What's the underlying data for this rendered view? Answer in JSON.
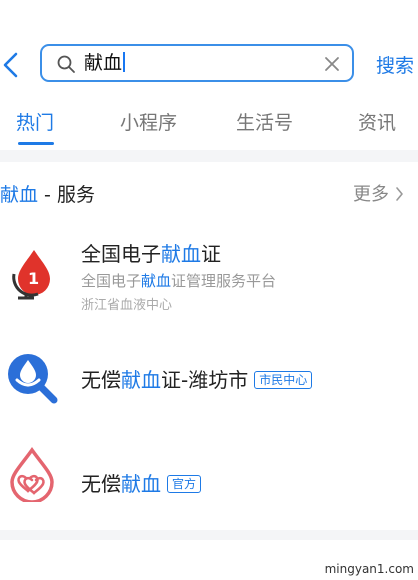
{
  "search": {
    "query": "献血",
    "submit_label": "搜索"
  },
  "tabs": [
    {
      "label": "热门",
      "active": true
    },
    {
      "label": "小程序",
      "active": false
    },
    {
      "label": "生活号",
      "active": false
    },
    {
      "label": "资讯",
      "active": false
    }
  ],
  "section": {
    "title_highlight": "献血",
    "title_rest": " - 服务",
    "more_label": "更多"
  },
  "results": [
    {
      "title_pre": "全国电子",
      "title_hl": "献血",
      "title_post": "证",
      "subtitle_pre": "全国电子",
      "subtitle_hl": "献血",
      "subtitle_post": "证管理服务平台",
      "source": "浙江省血液中心"
    },
    {
      "title_pre": "无偿",
      "title_hl": "献血",
      "title_post": "证-潍坊市",
      "badge": "市民中心"
    },
    {
      "title_pre": "无偿",
      "title_hl": "献血",
      "title_post": "",
      "badge": "官方"
    }
  ],
  "watermark": "mingyan1.com",
  "colors": {
    "accent": "#1e7ae6",
    "search_border": "#3b8fe8",
    "background": "#f4f5f7",
    "icon_red": "#e0332b",
    "icon_blue": "#2b6fd8",
    "icon_pink": "#e4656f"
  },
  "icons": {
    "back": "chevron-left-icon",
    "search": "magnifier-icon",
    "clear": "close-icon",
    "more": "chevron-right-icon",
    "result_1": "blood-drop-globe-icon",
    "result_2": "blue-drop-magnifier-icon",
    "result_3": "heart-drop-icon"
  }
}
